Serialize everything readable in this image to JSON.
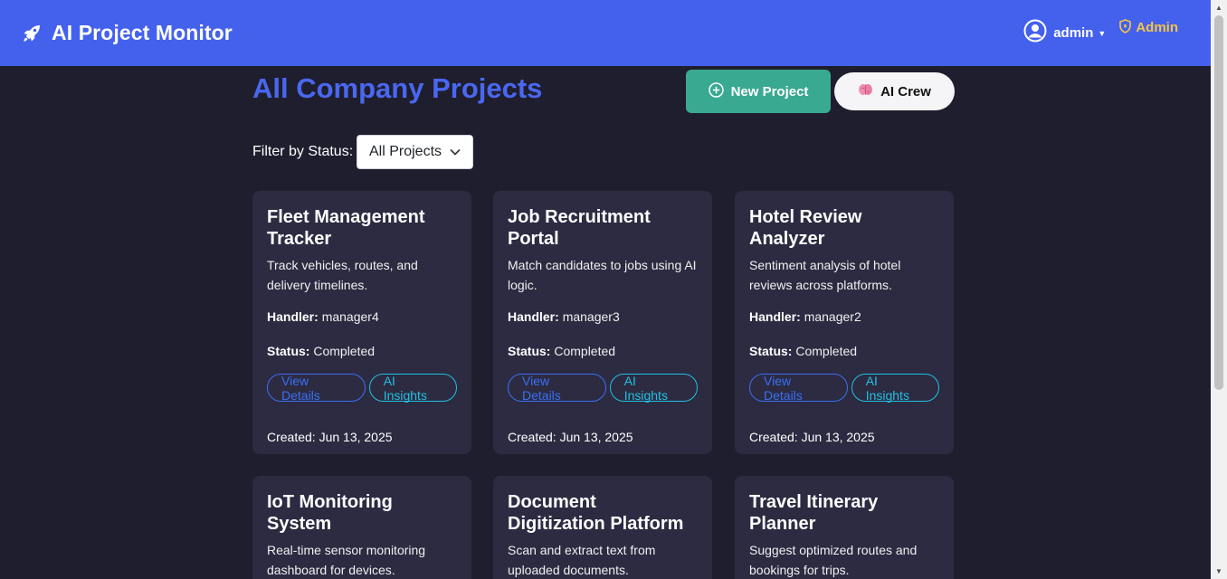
{
  "navbar": {
    "brand_title": "AI Project Monitor",
    "brand_icon": "rocket-icon",
    "user_name": "admin",
    "user_icon": "user-circle-icon",
    "admin_label": "Admin",
    "admin_icon": "shield-icon"
  },
  "colors": {
    "navbar": "#4461ee",
    "background": "#1f1e2e",
    "card": "#2c2b42",
    "title": "#4a67f0",
    "new_project_button": "#3aa991",
    "admin_badge": "#f4c542",
    "view_details": "#3b6ff2",
    "ai_insights": "#23c0de"
  },
  "page": {
    "title": "All Company Projects",
    "new_project_label": "New Project",
    "ai_crew_label": "AI Crew",
    "filter_label": "Filter by Status:",
    "filter_value": "All Projects"
  },
  "labels": {
    "handler": "Handler:",
    "status": "Status:",
    "view_details": "View Details",
    "ai_insights": "AI Insights"
  },
  "projects": [
    {
      "title": "Fleet Management Tracker",
      "description": "Track vehicles, routes, and delivery timelines.",
      "handler": "manager4",
      "status": "Completed",
      "created": "Created: Jun 13, 2025"
    },
    {
      "title": "Job Recruitment Portal",
      "description": "Match candidates to jobs using AI logic.",
      "handler": "manager3",
      "status": "Completed",
      "created": "Created: Jun 13, 2025"
    },
    {
      "title": "Hotel Review Analyzer",
      "description": "Sentiment analysis of hotel reviews across platforms.",
      "handler": "manager2",
      "status": "Completed",
      "created": "Created: Jun 13, 2025"
    },
    {
      "title": "IoT Monitoring System",
      "description": "Real-time sensor monitoring dashboard for devices."
    },
    {
      "title": "Document Digitization Platform",
      "description": "Scan and extract text from uploaded documents."
    },
    {
      "title": "Travel Itinerary Planner",
      "description": "Suggest optimized routes and bookings for trips."
    }
  ]
}
